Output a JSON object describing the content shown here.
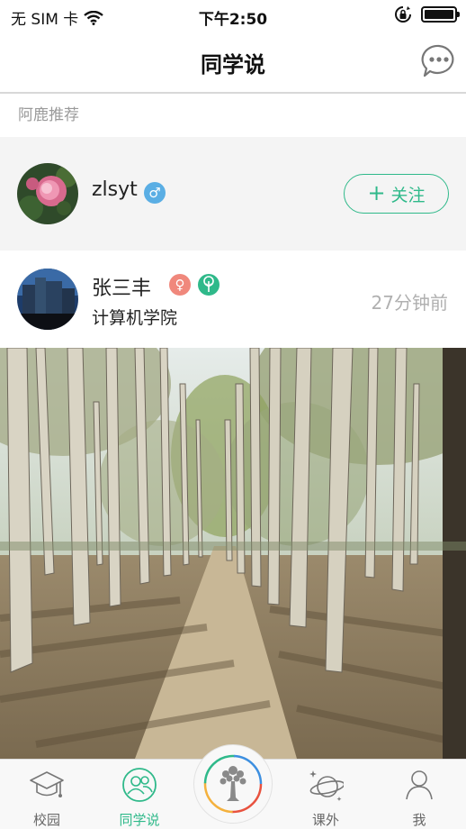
{
  "status_bar": {
    "carrier": "无 SIM 卡",
    "time": "下午2:50",
    "battery_level": 1.0
  },
  "nav": {
    "title": "同学说",
    "chat_icon": "chat-bubble-icon"
  },
  "recommend": {
    "section_label": "阿鹿推荐",
    "user": {
      "name": "zlsyt",
      "gender_symbol": "♂",
      "follow_label": "关注"
    }
  },
  "post": {
    "author": "张三丰",
    "gender_symbol": "♀",
    "college": "计算机学院",
    "time_ago": "27分钟前"
  },
  "tabs": [
    {
      "label": "校园",
      "icon": "graduation-cap-icon"
    },
    {
      "label": "同学说",
      "icon": "people-icon",
      "active": true
    },
    {
      "label": "",
      "icon": "tree-logo-icon"
    },
    {
      "label": "课外",
      "icon": "planet-icon"
    },
    {
      "label": "我",
      "icon": "person-icon"
    }
  ],
  "colors": {
    "accent": "#2fb98a",
    "male": "#5aaee4",
    "female": "#f0887c"
  }
}
